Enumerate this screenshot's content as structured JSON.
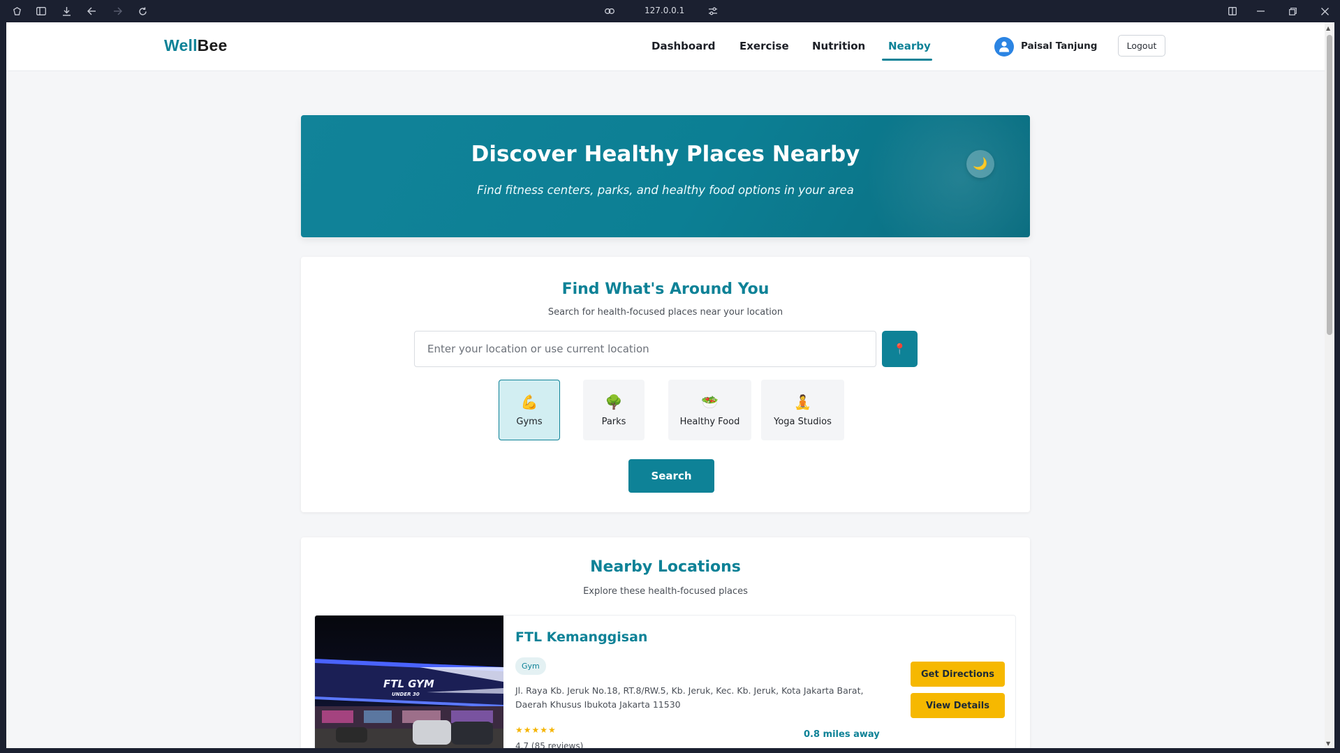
{
  "browser": {
    "url": "127.0.0.1"
  },
  "navbar": {
    "brand_part1": "Well",
    "brand_part2": "Bee",
    "links": [
      "Dashboard",
      "Exercise",
      "Nutrition",
      "Nearby"
    ],
    "active_link": "Nearby",
    "user_name": "Paisal Tanjung",
    "logout_label": "Logout"
  },
  "hero": {
    "title": "Discover Healthy Places Nearby",
    "subtitle": "Find fitness centers, parks, and healthy food options in your area",
    "theme_toggle_icon": "🌙"
  },
  "search": {
    "title": "Find What's Around You",
    "subtitle": "Search for health-focused places near your location",
    "location_placeholder": "Enter your location or use current location",
    "location_value": "",
    "pin_icon": "📍",
    "categories": [
      {
        "emoji": "💪",
        "label": "Gyms",
        "active": true
      },
      {
        "emoji": "🌳",
        "label": "Parks",
        "active": false
      },
      {
        "emoji": "🥗",
        "label": "Healthy Food",
        "active": false
      },
      {
        "emoji": "🧘",
        "label": "Yoga Studios",
        "active": false
      }
    ],
    "search_label": "Search"
  },
  "results": {
    "title": "Nearby Locations",
    "subtitle": "Explore these health-focused places",
    "places": [
      {
        "name": "FTL Kemanggisan",
        "image_sign_line1": "FTL GYM",
        "image_sign_line2": "UNDER 30",
        "tag": "Gym",
        "address": "Jl. Raya Kb. Jeruk No.18, RT.8/RW.5, Kb. Jeruk, Kec. Kb. Jeruk, Kota Jakarta Barat, Daerah Khusus Ibukota Jakarta 11530",
        "stars": "★★★★★",
        "rating": "4.7 (85 reviews)",
        "distance": "0.8 miles away",
        "directions_label": "Get Directions",
        "details_label": "View Details"
      }
    ]
  },
  "colors": {
    "accent": "#0e8297",
    "button_gold": "#f6b800",
    "active_category_bg": "#d2eef2"
  }
}
